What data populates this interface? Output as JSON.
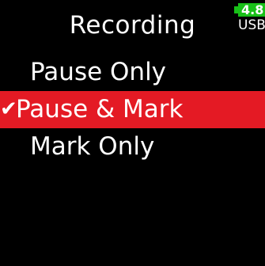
{
  "header": {
    "title": "Recording",
    "battery": {
      "level": "4.8",
      "source": "USB",
      "color": "#18c018"
    }
  },
  "menu": {
    "items": [
      {
        "label": "Pause Only",
        "selected": false
      },
      {
        "label": "Pause & Mark",
        "selected": true,
        "check_icon": "✔"
      },
      {
        "label": "Mark Only",
        "selected": false
      }
    ],
    "highlight_color": "#e41a24"
  }
}
